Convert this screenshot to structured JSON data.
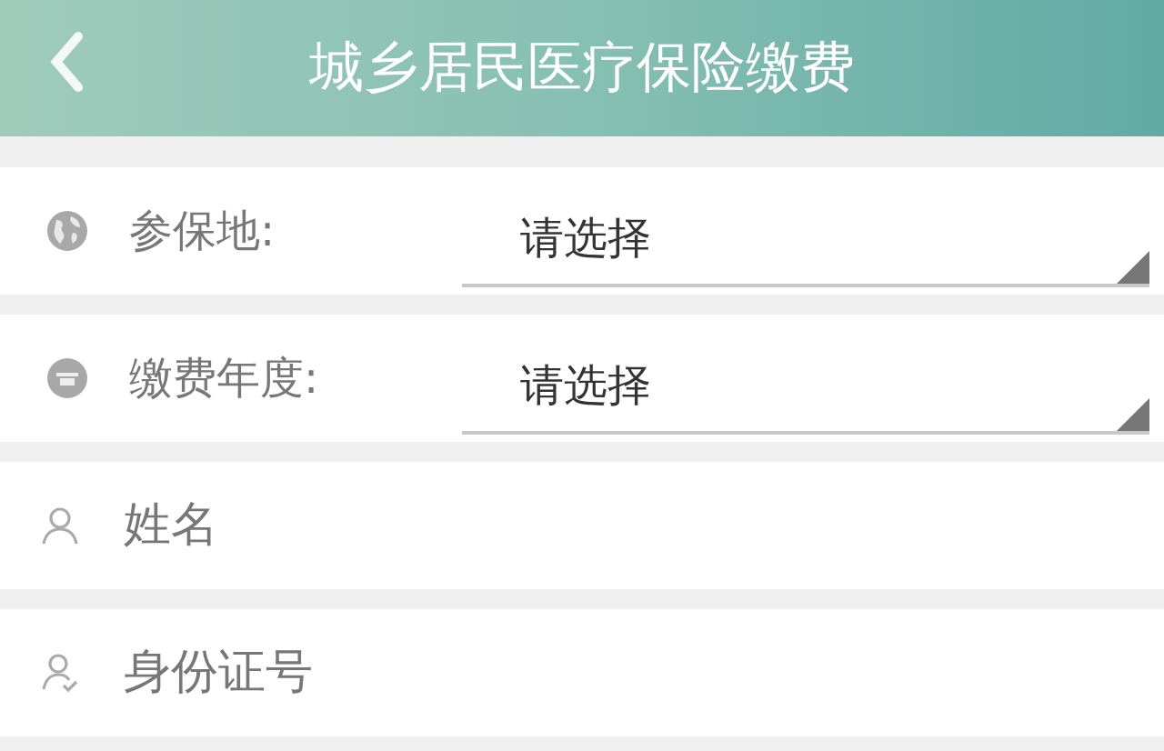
{
  "header": {
    "title": "城乡居民医疗保险缴费"
  },
  "fields": [
    {
      "kind": "select",
      "label": "参保地:",
      "value": "请选择"
    },
    {
      "kind": "select",
      "label": "缴费年度:",
      "value": "请选择"
    },
    {
      "kind": "input",
      "placeholder": "姓名"
    },
    {
      "kind": "input",
      "placeholder": "身份证号"
    }
  ]
}
